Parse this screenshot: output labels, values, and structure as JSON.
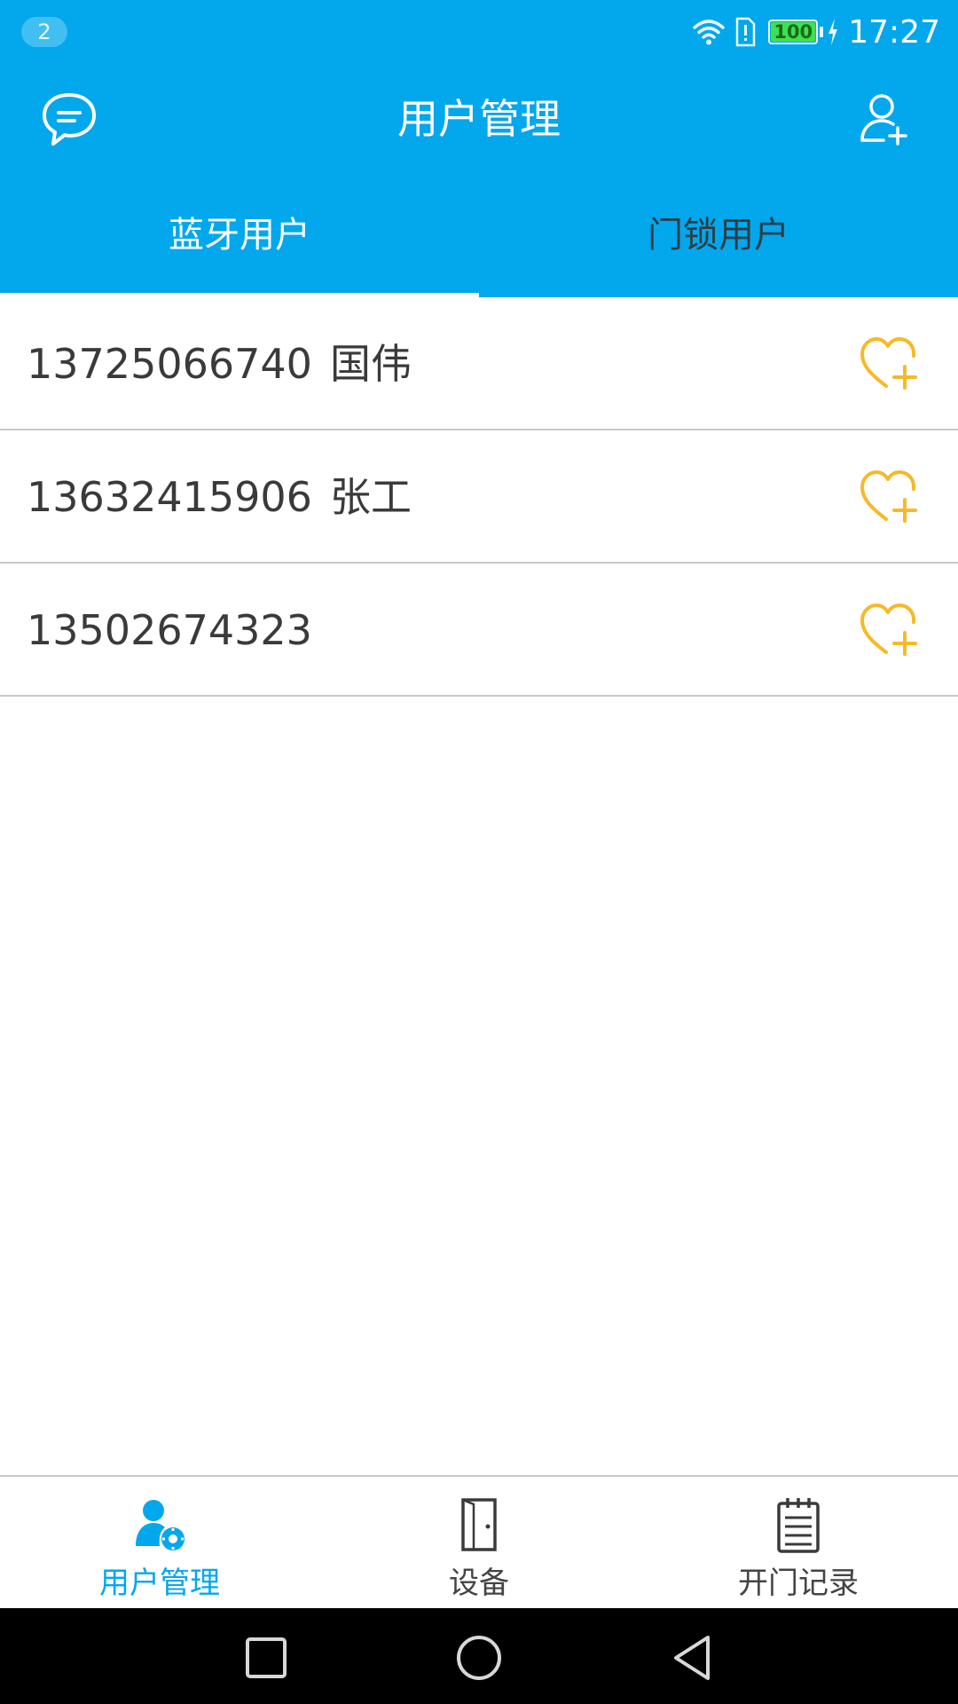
{
  "status_bar": {
    "notification_count": "2",
    "battery_level": "100",
    "time": "17:27"
  },
  "toolbar": {
    "title": "用户管理"
  },
  "tabs": [
    {
      "label": "蓝牙用户",
      "active": true
    },
    {
      "label": "门锁用户",
      "active": false
    }
  ],
  "users": [
    {
      "phone": "13725066740",
      "name": "国伟"
    },
    {
      "phone": "13632415906",
      "name": "张工"
    },
    {
      "phone": "13502674323",
      "name": ""
    }
  ],
  "bottom_nav": [
    {
      "label": "用户管理",
      "icon": "user-settings-icon",
      "active": true
    },
    {
      "label": "设备",
      "icon": "door-icon",
      "active": false
    },
    {
      "label": "开门记录",
      "icon": "notepad-icon",
      "active": false
    }
  ],
  "colors": {
    "primary": "#03a7ec",
    "favorite_accent": "#f7b928",
    "divider": "#c8c8c8",
    "battery_fill": "#3fe14c"
  }
}
